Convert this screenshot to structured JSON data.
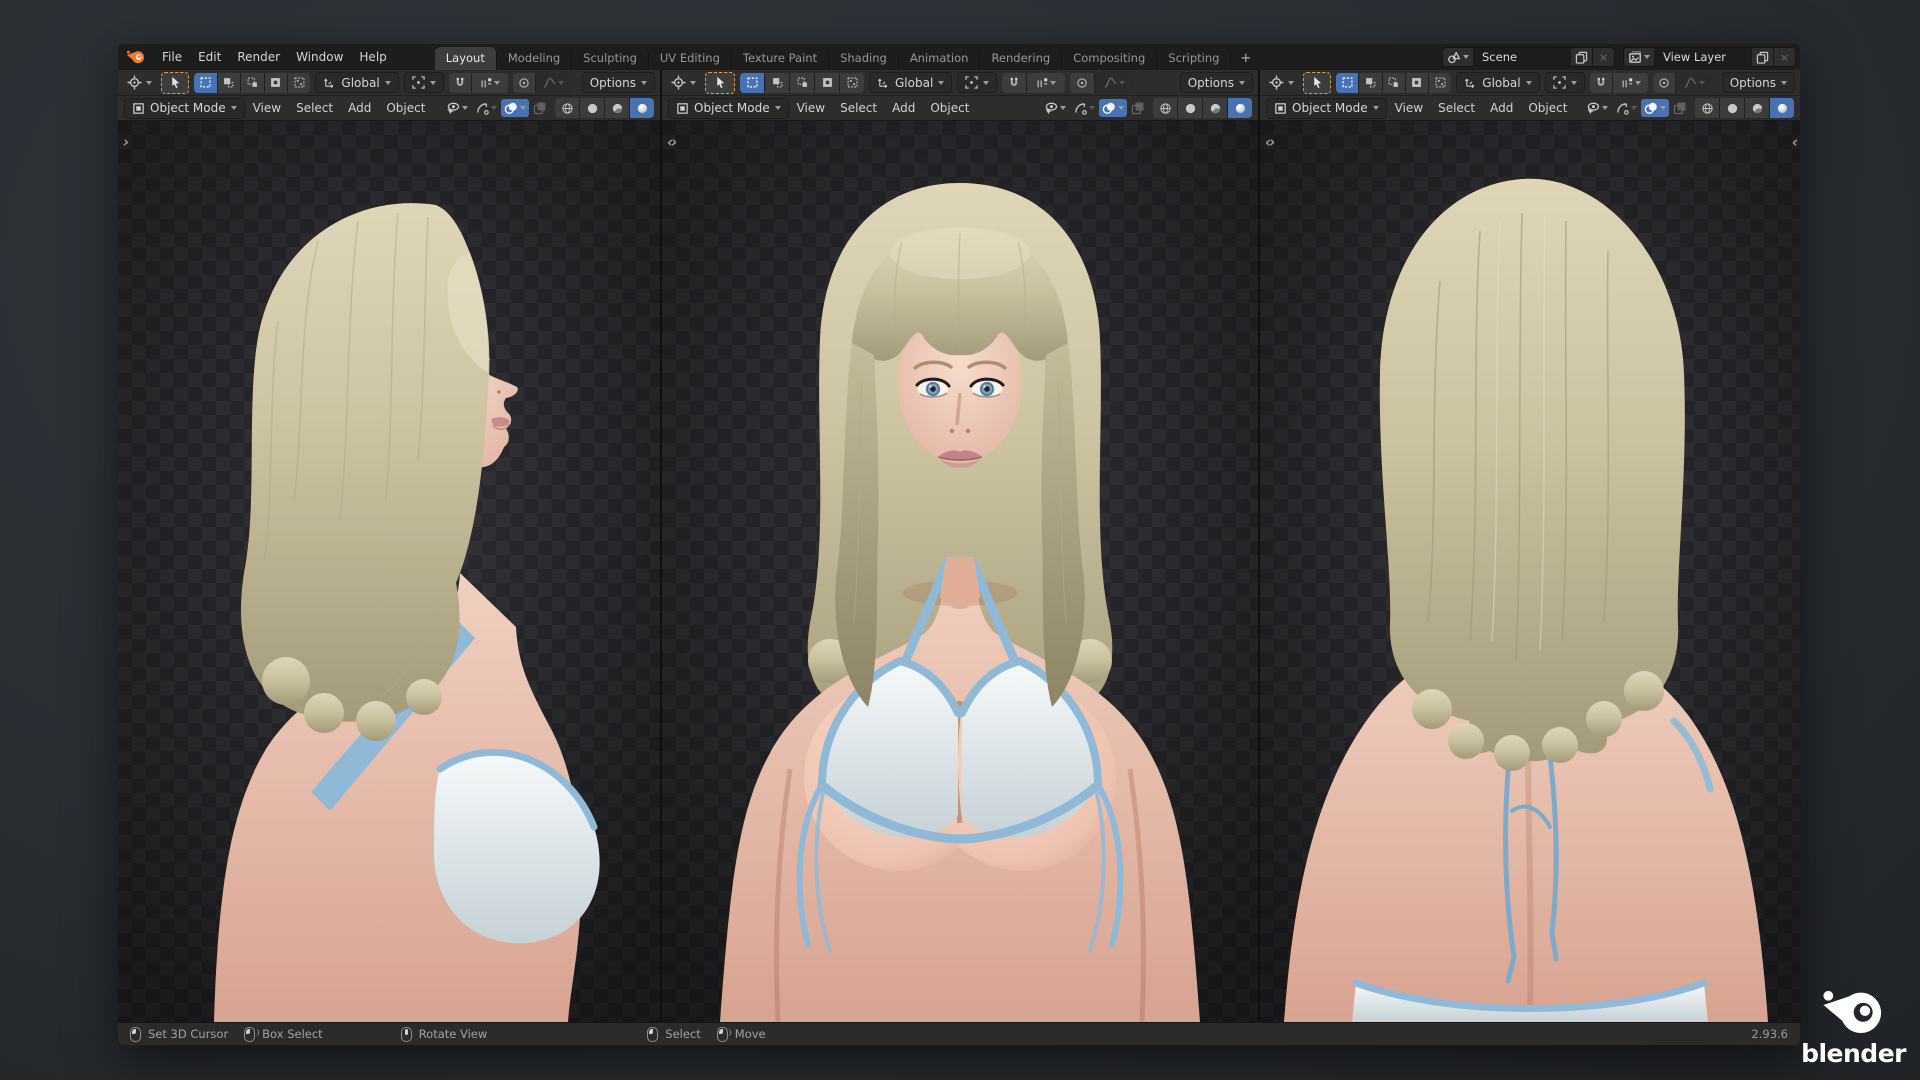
{
  "topbar": {
    "menus": [
      "File",
      "Edit",
      "Render",
      "Window",
      "Help"
    ],
    "workspaces": [
      "Layout",
      "Modeling",
      "Sculpting",
      "UV Editing",
      "Texture Paint",
      "Shading",
      "Animation",
      "Rendering",
      "Compositing",
      "Scripting"
    ],
    "active_workspace": "Layout",
    "add_workspace": "+",
    "scene": {
      "value": "Scene"
    },
    "view_layer": {
      "value": "View Layer"
    }
  },
  "tool_settings": {
    "orientation": "Global",
    "options": "Options"
  },
  "viewport": {
    "mode": "Object Mode",
    "menu_view": "View",
    "menu_select": "Select",
    "menu_add": "Add",
    "menu_object": "Object"
  },
  "statusbar": {
    "hints": [
      {
        "icon": "mouse-left-click",
        "label": "Set 3D Cursor"
      },
      {
        "icon": "mouse-left-drag",
        "label": "Box Select"
      },
      {
        "icon": "mouse-middle-drag",
        "label": "Rotate View"
      },
      {
        "icon": "mouse-left-click",
        "label": "Select"
      },
      {
        "icon": "mouse-left-drag",
        "label": "Move"
      }
    ],
    "version": "2.93.6"
  },
  "brand": {
    "wordmark": "blender"
  },
  "icons": {
    "corner_left": "‹",
    "corner_right": "›",
    "close": "×"
  },
  "colors": {
    "accent_blue": "#4772b3",
    "tool_outline_orange": "#e89b3f",
    "hair": "#cfc6a4",
    "skin": "#e9c2b2",
    "bikini_blue": "#8fb9d6",
    "bikini_white": "#eef1f2",
    "checker_a": "#2c2c30",
    "checker_b": "#242428"
  },
  "scene_view": {
    "subject": "Female character model with blonde hair and light blue bikini top, rendered shading",
    "angles": [
      "side profile",
      "front",
      "back"
    ]
  }
}
